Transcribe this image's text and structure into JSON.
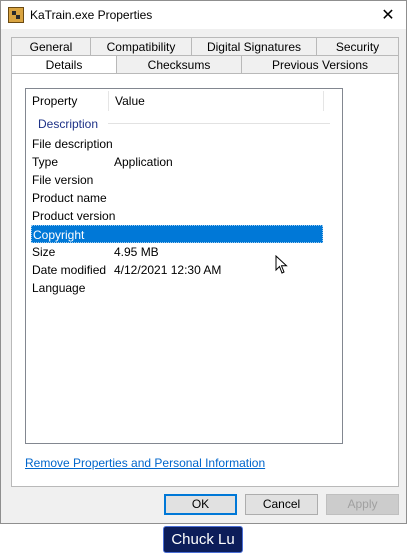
{
  "window": {
    "title": "KaTrain.exe Properties",
    "close_glyph": "✕"
  },
  "tabs_row1": [
    {
      "label": "General"
    },
    {
      "label": "Compatibility"
    },
    {
      "label": "Digital Signatures"
    },
    {
      "label": "Security"
    }
  ],
  "tabs_row2": [
    {
      "label": "Details",
      "active": true
    },
    {
      "label": "Checksums"
    },
    {
      "label": "Previous Versions"
    }
  ],
  "details": {
    "columns": [
      "Property",
      "Value"
    ],
    "group": "Description",
    "rows": [
      {
        "property": "File description",
        "value": ""
      },
      {
        "property": "Type",
        "value": "Application"
      },
      {
        "property": "File version",
        "value": ""
      },
      {
        "property": "Product name",
        "value": ""
      },
      {
        "property": "Product version",
        "value": ""
      },
      {
        "property": "Copyright",
        "value": "",
        "selected": true
      },
      {
        "property": "Size",
        "value": "4.95 MB"
      },
      {
        "property": "Date modified",
        "value": "4/12/2021 12:30 AM"
      },
      {
        "property": "Language",
        "value": ""
      }
    ]
  },
  "remove_link": "Remove Properties and Personal Information",
  "buttons": {
    "ok": "OK",
    "cancel": "Cancel",
    "apply": "Apply"
  },
  "watermark": "Chuck Lu",
  "colors": {
    "selection": "#0078d7",
    "group_heading": "#1e3287",
    "link": "#0066cc",
    "watermark_bg": "#0c1d5a"
  }
}
